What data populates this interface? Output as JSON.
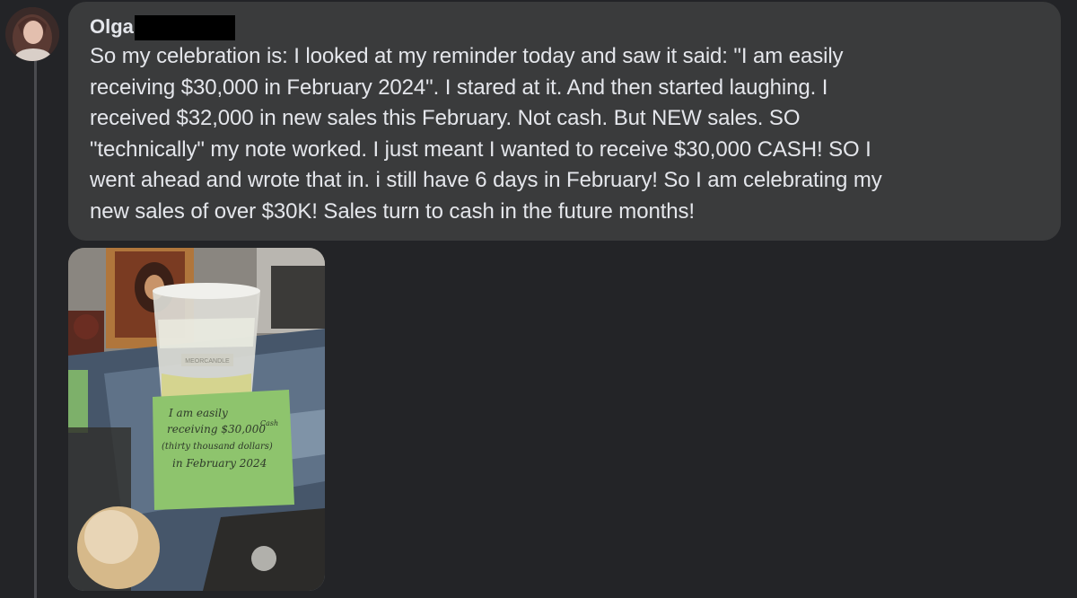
{
  "comment": {
    "author": "Olga",
    "text_lines": [
      "So my celebration is: I looked at my reminder today and saw it said: \"I am easily",
      "receiving $30,000 in February 2024\". I stared at it. And then started laughing. I",
      "received $32,000 in new sales this February. Not cash. But NEW sales. SO",
      "\"technically\" my note worked. I just meant I wanted to receive $30,000 CASH! SO I",
      "went ahead and wrote that in. i still have 6 days in February! So I am celebrating my",
      "new sales of over $30K! Sales turn to cash in the future months!"
    ]
  },
  "photo": {
    "candle_label": "MEORCANDLE",
    "sticky_note": {
      "lines": [
        "I am easily",
        "receiving $30,000",
        "(thirty thousand dollars)",
        "in February 2024"
      ],
      "handwritten_addition": "Cash"
    }
  }
}
